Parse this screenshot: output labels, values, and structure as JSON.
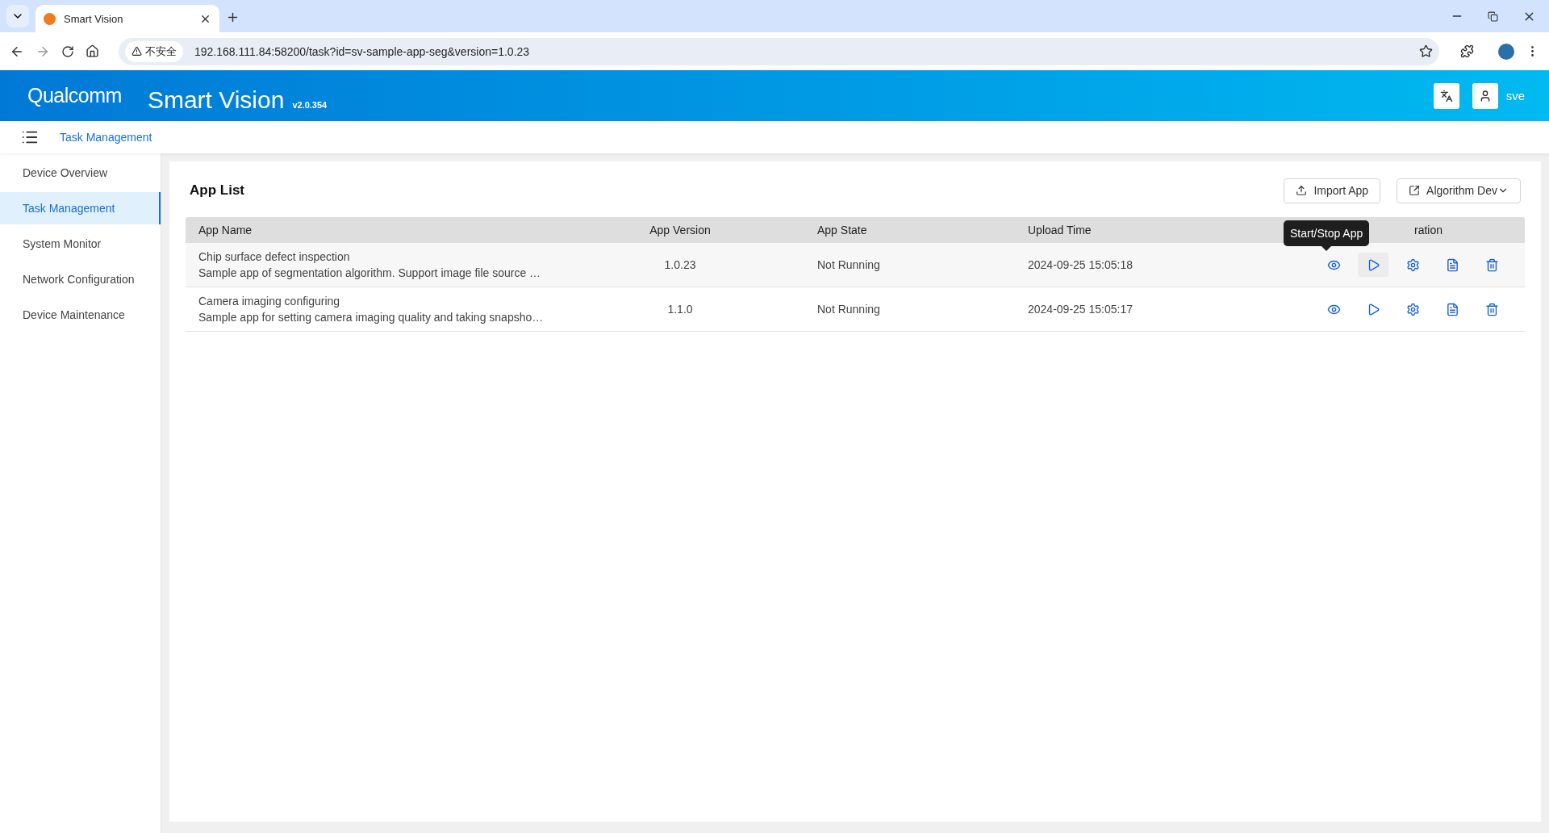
{
  "browser": {
    "tab_title": "Smart Vision",
    "security_label": "不安全",
    "url": "192.168.111.84:58200/task?id=sv-sample-app-seg&version=1.0.23"
  },
  "header": {
    "logo": "Qualcomm",
    "title": "Smart Vision",
    "version": "v2.0.354",
    "user": "sve"
  },
  "breadcrumb": "Task Management",
  "sidebar": {
    "items": [
      {
        "label": "Device Overview",
        "selected": false
      },
      {
        "label": "Task Management",
        "selected": true
      },
      {
        "label": "System Monitor",
        "selected": false
      },
      {
        "label": "Network Configuration",
        "selected": false
      },
      {
        "label": "Device Maintenance",
        "selected": false
      }
    ]
  },
  "panel": {
    "title": "App List",
    "buttons": [
      {
        "label": "Import App",
        "kind": "upload"
      },
      {
        "label": "Algorithm Dev",
        "kind": "dropdown"
      }
    ]
  },
  "table": {
    "columns": [
      "App Name",
      "App Version",
      "App State",
      "Upload Time",
      "ration"
    ],
    "rows": [
      {
        "name": "Chip surface defect inspection",
        "description": "Sample app of segmentation algorithm. Support image file source …",
        "version": "1.0.23",
        "state": "Not Running",
        "upload_time": "2024-09-25 15:05:18",
        "hovered": true
      },
      {
        "name": "Camera imaging configuring",
        "description": "Sample app for setting camera imaging quality and taking snapsho…",
        "version": "1.1.0",
        "state": "Not Running",
        "upload_time": "2024-09-25 15:05:17",
        "hovered": false
      }
    ]
  },
  "tooltip": {
    "text": "Start/Stop App"
  }
}
